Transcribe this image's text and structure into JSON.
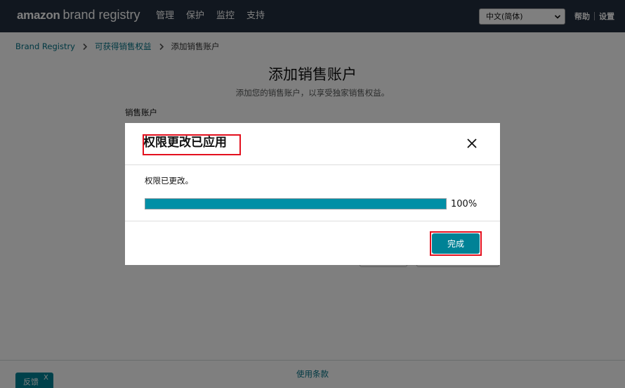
{
  "header": {
    "logo_brand": "amazon",
    "logo_product": "brand registry",
    "nav": [
      {
        "label": "管理"
      },
      {
        "label": "保护"
      },
      {
        "label": "监控"
      },
      {
        "label": "支持"
      }
    ],
    "language_selected": "中文(简体)",
    "help_label": "帮助",
    "settings_label": "设置"
  },
  "breadcrumb": {
    "root": "Brand Registry",
    "parent": "可获得销售权益",
    "current": "添加销售账户"
  },
  "page": {
    "title": "添加销售账户",
    "subtitle": "添加您的销售账户，以享受独家销售权益。",
    "field_label": "销售账户"
  },
  "footer": {
    "terms_link": "使用条款",
    "feedback_label": "反馈",
    "feedback_close": "X"
  },
  "modal": {
    "title": "权限更改已应用",
    "status": "权限已更改。",
    "progress_value": 100,
    "progress_label": "100%",
    "done_label": "完成"
  },
  "colors": {
    "nav_bg": "#232f3e",
    "accent": "#008296",
    "progress_fill": "#008fa6",
    "highlight_border": "#e3101e",
    "link": "#007185"
  }
}
